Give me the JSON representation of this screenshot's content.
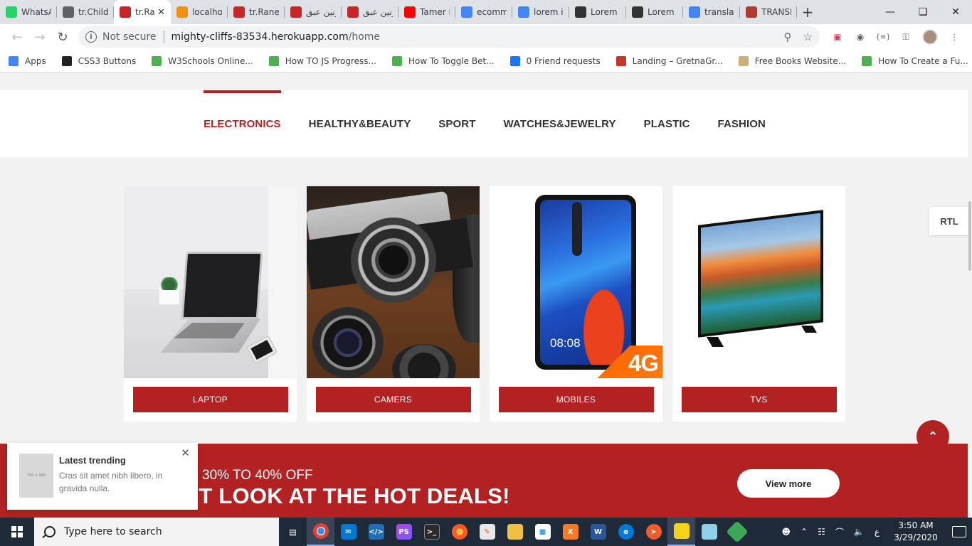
{
  "browser": {
    "tabs": [
      {
        "title": "WhatsA",
        "icon": "whatsapp-icon",
        "color": "#25d366"
      },
      {
        "title": "tr.Child",
        "icon": "globe-icon",
        "color": "#5f6368"
      },
      {
        "title": "tr.Ra",
        "icon": "arabic-logo-icon",
        "color": "#c62828",
        "active": true
      },
      {
        "title": "localho",
        "icon": "pma-icon",
        "color": "#f29111"
      },
      {
        "title": "tr.Ranee",
        "icon": "arabic-logo-icon",
        "color": "#c62828"
      },
      {
        "title": "رنين عبق",
        "icon": "arabic-logo-icon",
        "color": "#c62828"
      },
      {
        "title": "رنين عبق",
        "icon": "arabic-logo-icon",
        "color": "#c62828"
      },
      {
        "title": "Tamer H",
        "icon": "youtube-icon",
        "color": "#ff0000"
      },
      {
        "title": "ecomm",
        "icon": "google-icon",
        "color": "#4285f4"
      },
      {
        "title": "lorem ip",
        "icon": "google-icon",
        "color": "#4285f4"
      },
      {
        "title": "Lorem I",
        "icon": "lipsum-icon",
        "color": "#333333"
      },
      {
        "title": "Lorem I",
        "icon": "lipsum-icon",
        "color": "#333333"
      },
      {
        "title": "translat",
        "icon": "google-icon",
        "color": "#4285f4"
      },
      {
        "title": "TRANSL",
        "icon": "shield-crest-icon",
        "color": "#b33a2f"
      }
    ],
    "address": {
      "security_label": "Not secure",
      "host": "mighty-cliffs-83534.herokuapp.com",
      "path": "/home"
    },
    "bookmarks": [
      {
        "label": "Apps",
        "icon": "apps-grid-icon",
        "color": "#4285f4"
      },
      {
        "label": "CSS3 Buttons",
        "icon": "codepen-icon",
        "color": "#222222"
      },
      {
        "label": "W3Schools Online...",
        "icon": "w3schools-icon",
        "color": "#4caf50"
      },
      {
        "label": "How TO JS Progress...",
        "icon": "w3schools-icon",
        "color": "#4caf50"
      },
      {
        "label": "How To Toggle Bet...",
        "icon": "w3schools-icon",
        "color": "#4caf50"
      },
      {
        "label": "0 Friend requests",
        "icon": "facebook-icon",
        "color": "#1877f2"
      },
      {
        "label": "Landing – GretnaGr...",
        "icon": "landing-icon",
        "color": "#c0392b"
      },
      {
        "label": "Free Books Website...",
        "icon": "book-icon",
        "color": "#c9b27a"
      },
      {
        "label": "How To Create a Fu...",
        "icon": "w3schools-icon",
        "color": "#4caf50"
      }
    ]
  },
  "page": {
    "categories": [
      "ELECTRONICS",
      "HEALTHY&BEAUTY",
      "SPORT",
      "WATCHES&JEWELRY",
      "PLASTIC",
      "FASHION"
    ],
    "active_category": "ELECTRONICS",
    "products": [
      {
        "label": "LAPTOP"
      },
      {
        "label": "CAMERS"
      },
      {
        "label": "MOBILES",
        "screen_time": "08:08",
        "badge": "4G"
      },
      {
        "label": "TVS"
      }
    ],
    "rtl_label": "RTL",
    "deals": {
      "subtitle": "30% TO 40% OFF",
      "headline": "UST LOOK AT THE HOT DEALS!",
      "cta": "View more"
    },
    "trending": {
      "title": "Latest trending",
      "text": "Cras sit amet nibh libero, in gravida nulla.",
      "thumb_text": "768 × 968"
    },
    "accent_color": "#b22222"
  },
  "taskbar": {
    "search_placeholder": "Type here to search",
    "time": "3:50 AM",
    "date": "3/29/2020",
    "lang": "ع"
  }
}
